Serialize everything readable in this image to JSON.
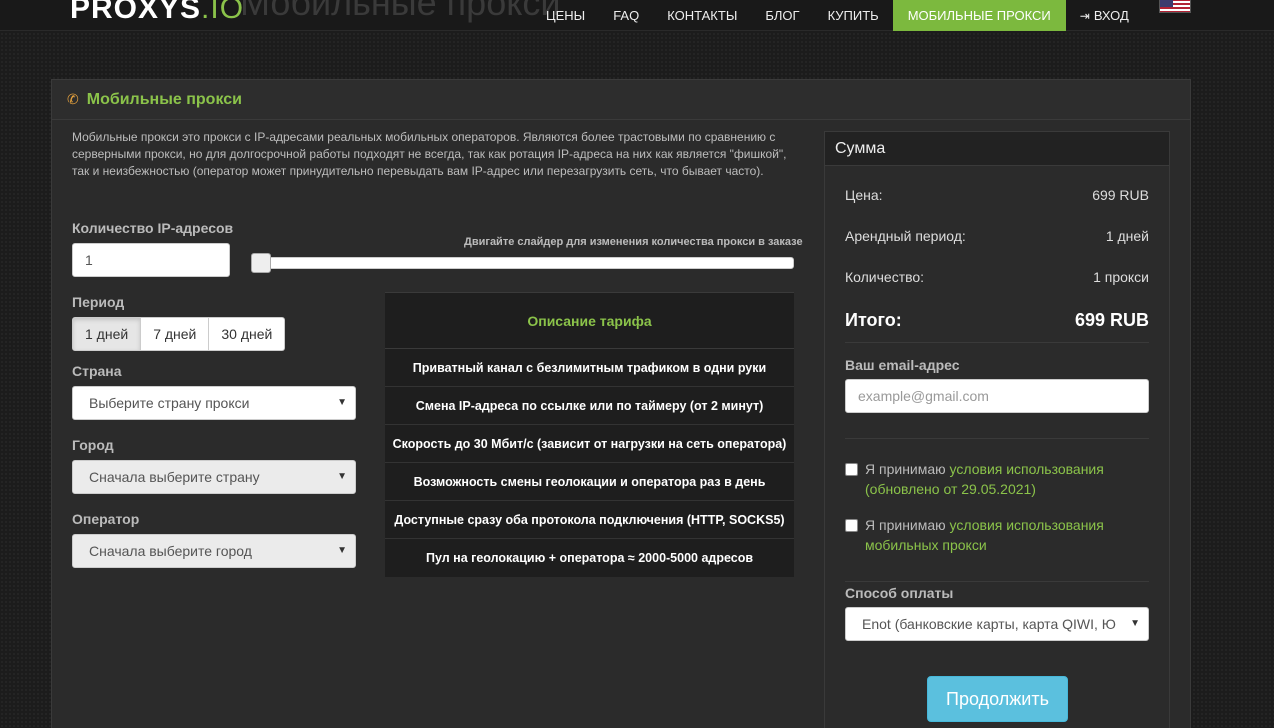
{
  "header": {
    "logo_main": "PROXYS",
    "logo_suffix": ".IO",
    "ghost_title": "Мобильные прокси",
    "nav": [
      {
        "label": "ЦЕНЫ"
      },
      {
        "label": "FAQ"
      },
      {
        "label": "КОНТАКТЫ"
      },
      {
        "label": "БЛОГ"
      },
      {
        "label": "КУПИТЬ"
      },
      {
        "label": "МОБИЛЬНЫЕ ПРОКСИ"
      },
      {
        "label": "ВХОД"
      }
    ]
  },
  "panel": {
    "title": "Мобильные прокси",
    "description": "Мобильные прокси это прокси с IP-адресами реальных мобильных операторов. Являются более трастовыми по сравнению с серверными прокси, но для долгосрочной работы подходят не всегда, так как ротация IP-адреса на них как является \"фишкой\", так и неизбежностью (оператор может принудительно перевыдать вам IP-адрес или перезагрузить сеть, что бывает часто).",
    "quantity_label": "Количество IP-адресов",
    "quantity_value": "1",
    "slider_hint": "Двигайте слайдер для изменения количества прокси в заказе",
    "slider_fraction": 0.0,
    "period_label": "Период",
    "periods": [
      "1 дней",
      "7 дней",
      "30 дней"
    ],
    "period_selected": "1 дней",
    "country_label": "Страна",
    "country_value": "Выберите страну прокси",
    "city_label": "Город",
    "city_value": "Сначала выберите страну",
    "operator_label": "Оператор",
    "operator_value": "Сначала выберите город"
  },
  "tariff": {
    "heading": "Описание тарифа",
    "rows": [
      "Приватный канал с безлимитным трафиком в одни руки",
      "Смена IP-адреса по ссылке или по таймеру (от 2 минут)",
      "Скорость до 30 Мбит/с (зависит от нагрузки на сеть оператора)",
      "Возможность смены геолокации и оператора раз в день",
      "Доступные сразу оба протокола подключения (HTTP, SOCKS5)",
      "Пул на геолокацию + оператора ≈ 2000-5000 адресов"
    ]
  },
  "summary": {
    "title": "Сумма",
    "price_label": "Цена:",
    "price_value": "699 RUB",
    "period_label": "Арендный период:",
    "period_value": "1 дней",
    "quantity_label": "Количество:",
    "quantity_value": "1 прокси",
    "total_label": "Итого:",
    "total_value": "699 RUB",
    "email_label": "Ваш email-адрес",
    "email_placeholder": "example@gmail.com",
    "terms1_prefix": "Я принимаю",
    "terms1_link": "условия использования (обновлено от 29.05.2021)",
    "terms2_prefix": "Я принимаю",
    "terms2_link": "условия использования мобильных прокси",
    "payment_label": "Способ оплаты",
    "payment_value": "Enot (банковские карты, карта QIWI, Ю",
    "continue_label": "Продолжить"
  },
  "colors": {
    "accent_green": "#8bc34a",
    "nav_active": "#7cb93e",
    "button_blue": "#5bc0de"
  }
}
